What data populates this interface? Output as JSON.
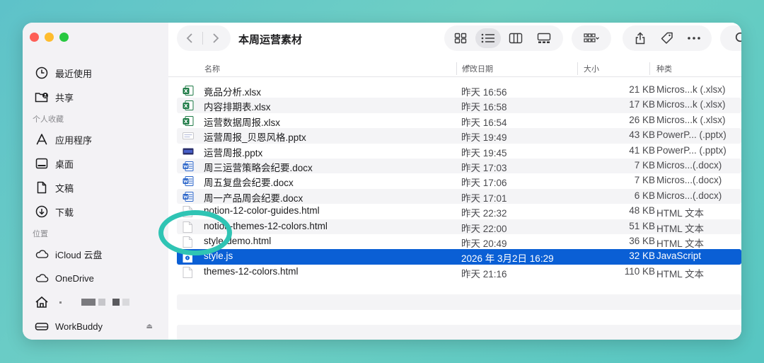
{
  "sidebar": {
    "items_top": [
      {
        "label": "最近使用",
        "icon": "clock-icon"
      },
      {
        "label": "共享",
        "icon": "shared-folder-icon"
      }
    ],
    "favorites_header": "个人收藏",
    "favorites": [
      {
        "label": "应用程序",
        "icon": "apps-icon"
      },
      {
        "label": "桌面",
        "icon": "desktop-icon"
      },
      {
        "label": "文稿",
        "icon": "document-icon"
      },
      {
        "label": "下载",
        "icon": "download-icon"
      }
    ],
    "locations_header": "位置",
    "locations": [
      {
        "label": "iCloud 云盘",
        "icon": "cloud-icon"
      },
      {
        "label": "OneDrive",
        "icon": "cloud-icon"
      },
      {
        "label": "",
        "icon": "home-icon"
      },
      {
        "label": "WorkBuddy",
        "icon": "drive-icon"
      }
    ]
  },
  "toolbar": {
    "title": "本周运营素材"
  },
  "columns": {
    "name": "名称",
    "modified": "修改日期",
    "size": "大小",
    "kind": "种类"
  },
  "files": [
    {
      "name": "竟品分析.xlsx",
      "modified": "昨天 16:56",
      "size": "21 KB",
      "kind": "Micros...k (.xlsx)",
      "type": "xlsx"
    },
    {
      "name": "内容排期表.xlsx",
      "modified": "昨天 16:58",
      "size": "17 KB",
      "kind": "Micros...k (.xlsx)",
      "type": "xlsx"
    },
    {
      "name": "运营数据周报.xlsx",
      "modified": "昨天 16:54",
      "size": "26 KB",
      "kind": "Micros...k (.xlsx)",
      "type": "xlsx"
    },
    {
      "name": "运营周报_贝恩风格.pptx",
      "modified": "昨天 19:49",
      "size": "43 KB",
      "kind": "PowerP... (.pptx)",
      "type": "pptx-light"
    },
    {
      "name": "运营周报.pptx",
      "modified": "昨天 19:45",
      "size": "41 KB",
      "kind": "PowerP... (.pptx)",
      "type": "pptx"
    },
    {
      "name": "周三运营策略会纪要.docx",
      "modified": "昨天 17:03",
      "size": "7 KB",
      "kind": "Micros...(.docx)",
      "type": "docx"
    },
    {
      "name": "周五复盘会纪要.docx",
      "modified": "昨天 17:06",
      "size": "7 KB",
      "kind": "Micros...(.docx)",
      "type": "docx"
    },
    {
      "name": "周一产品周会纪要.docx",
      "modified": "昨天 17:01",
      "size": "6 KB",
      "kind": "Micros...(.docx)",
      "type": "docx"
    },
    {
      "name": "notion-12-color-guides.html",
      "modified": "昨天 22:32",
      "size": "48 KB",
      "kind": "HTML 文本",
      "type": "html"
    },
    {
      "name": "notion-themes-12-colors.html",
      "modified": "昨天 22:00",
      "size": "51 KB",
      "kind": "HTML 文本",
      "type": "html"
    },
    {
      "name": "style-demo.html",
      "modified": "昨天 20:49",
      "size": "36 KB",
      "kind": "HTML 文本",
      "type": "html"
    },
    {
      "name": "style.js",
      "modified": "2026 年 3月2日 16:29",
      "size": "32 KB",
      "kind": "JavaScript",
      "type": "js",
      "selected": true
    },
    {
      "name": "themes-12-colors.html",
      "modified": "昨天 21:16",
      "size": "110 KB",
      "kind": "HTML 文本",
      "type": "html"
    }
  ],
  "colors": {
    "selection": "#0a5fd5",
    "highlight_ring": "#2fc4b4",
    "excel": "#1d7a45",
    "word": "#2b65c9"
  }
}
